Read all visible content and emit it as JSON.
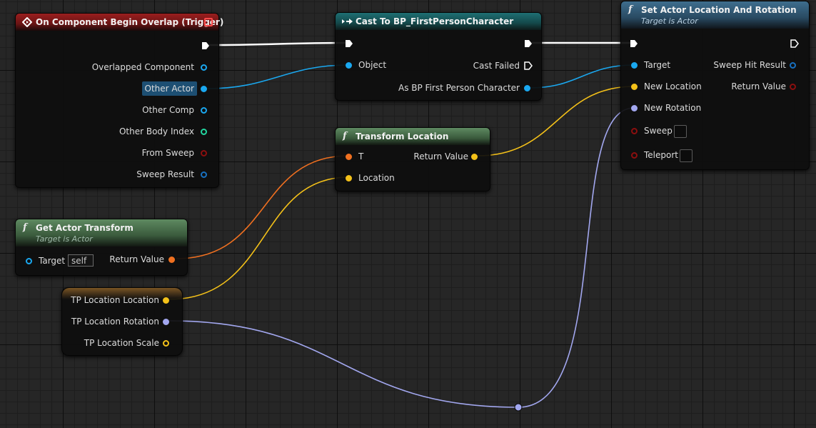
{
  "colors": {
    "exec": "#ffffff",
    "object": "#1aa8f0",
    "vector": "#f4c119",
    "rotator": "#a2a7ef",
    "transform": "#f07020",
    "bool": "#8b0f0f",
    "struct": "#1870c0",
    "int": "#22d6a0"
  },
  "event_node": {
    "title": "On Component Begin Overlap (Trigger)",
    "icon": "event-diamond-icon",
    "pins": [
      "Overlapped Component",
      "Other Actor",
      "Other Comp",
      "Other Body Index",
      "From Sweep",
      "Sweep Result"
    ]
  },
  "cast_node": {
    "title": "Cast To BP_FirstPersonCharacter",
    "icon": "cast-arrows-icon",
    "input_object": "Object",
    "cast_failed": "Cast Failed",
    "output": "As BP First Person Character"
  },
  "set_node": {
    "title": "Set Actor Location And Rotation",
    "subtitle": "Target is Actor",
    "icon": "function-icon",
    "inputs": [
      "Target",
      "New Location",
      "New Rotation",
      "Sweep",
      "Teleport"
    ],
    "outputs": [
      "Sweep Hit Result",
      "Return Value"
    ]
  },
  "transform_node": {
    "title": "Transform Location",
    "icon": "function-icon",
    "inputs": [
      "T",
      "Location"
    ],
    "output": "Return Value"
  },
  "get_transform_node": {
    "title": "Get Actor Transform",
    "subtitle": "Target is Actor",
    "icon": "function-icon",
    "input": "Target",
    "input_default": "self",
    "output": "Return Value"
  },
  "variable_node": {
    "pins": [
      "TP Location Location",
      "TP Location Rotation",
      "TP Location Scale"
    ]
  }
}
